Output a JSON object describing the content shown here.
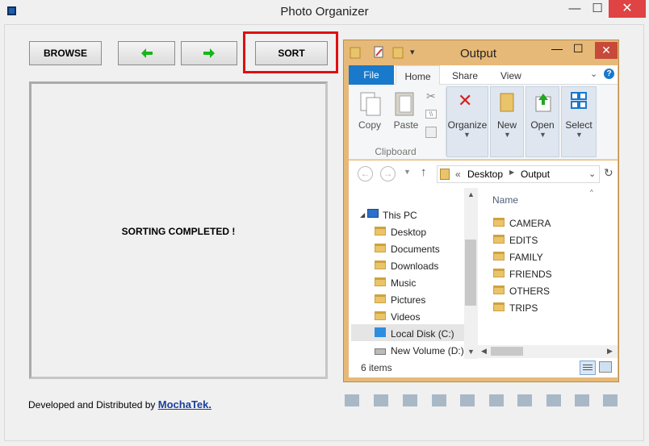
{
  "app": {
    "title": "Photo Organizer",
    "close_glyph": "✕",
    "min_glyph": "—",
    "max_glyph": "☐"
  },
  "toolbar": {
    "browse_label": "BROWSE",
    "sort_label": "SORT",
    "back_icon": "green-left-arrow-icon",
    "forward_icon": "green-right-arrow-icon"
  },
  "status": {
    "message": "SORTING COMPLETED !"
  },
  "footer": {
    "credit_prefix": "Developed and Distributed by",
    "credit_link": "MochaTek."
  },
  "explorer": {
    "title": "Output",
    "ribbon_tabs": [
      "File",
      "Home",
      "Share",
      "View"
    ],
    "ribbon_buttons": {
      "copy": "Copy",
      "paste": "Paste",
      "organize": "Organize",
      "new": "New",
      "open": "Open",
      "select": "Select"
    },
    "clipboard_group": "Clipboard",
    "address": {
      "prefix": "«",
      "parts": [
        "Desktop",
        "Output"
      ]
    },
    "nav": {
      "root": "This PC",
      "items": [
        "Desktop",
        "Documents",
        "Downloads",
        "Music",
        "Pictures",
        "Videos",
        "Local Disk (C:)",
        "New Volume (D:)"
      ]
    },
    "column_header": "Name",
    "folders": [
      "CAMERA",
      "EDITS",
      "FAMILY",
      "FRIENDS",
      "OTHERS",
      "TRIPS"
    ],
    "item_count": "6 items"
  },
  "colors": {
    "accent": "#1979ca",
    "highlight_border": "#e01010",
    "close_red": "#e04343",
    "explorer_frame": "#e7b978",
    "link": "#1a3f9c"
  }
}
